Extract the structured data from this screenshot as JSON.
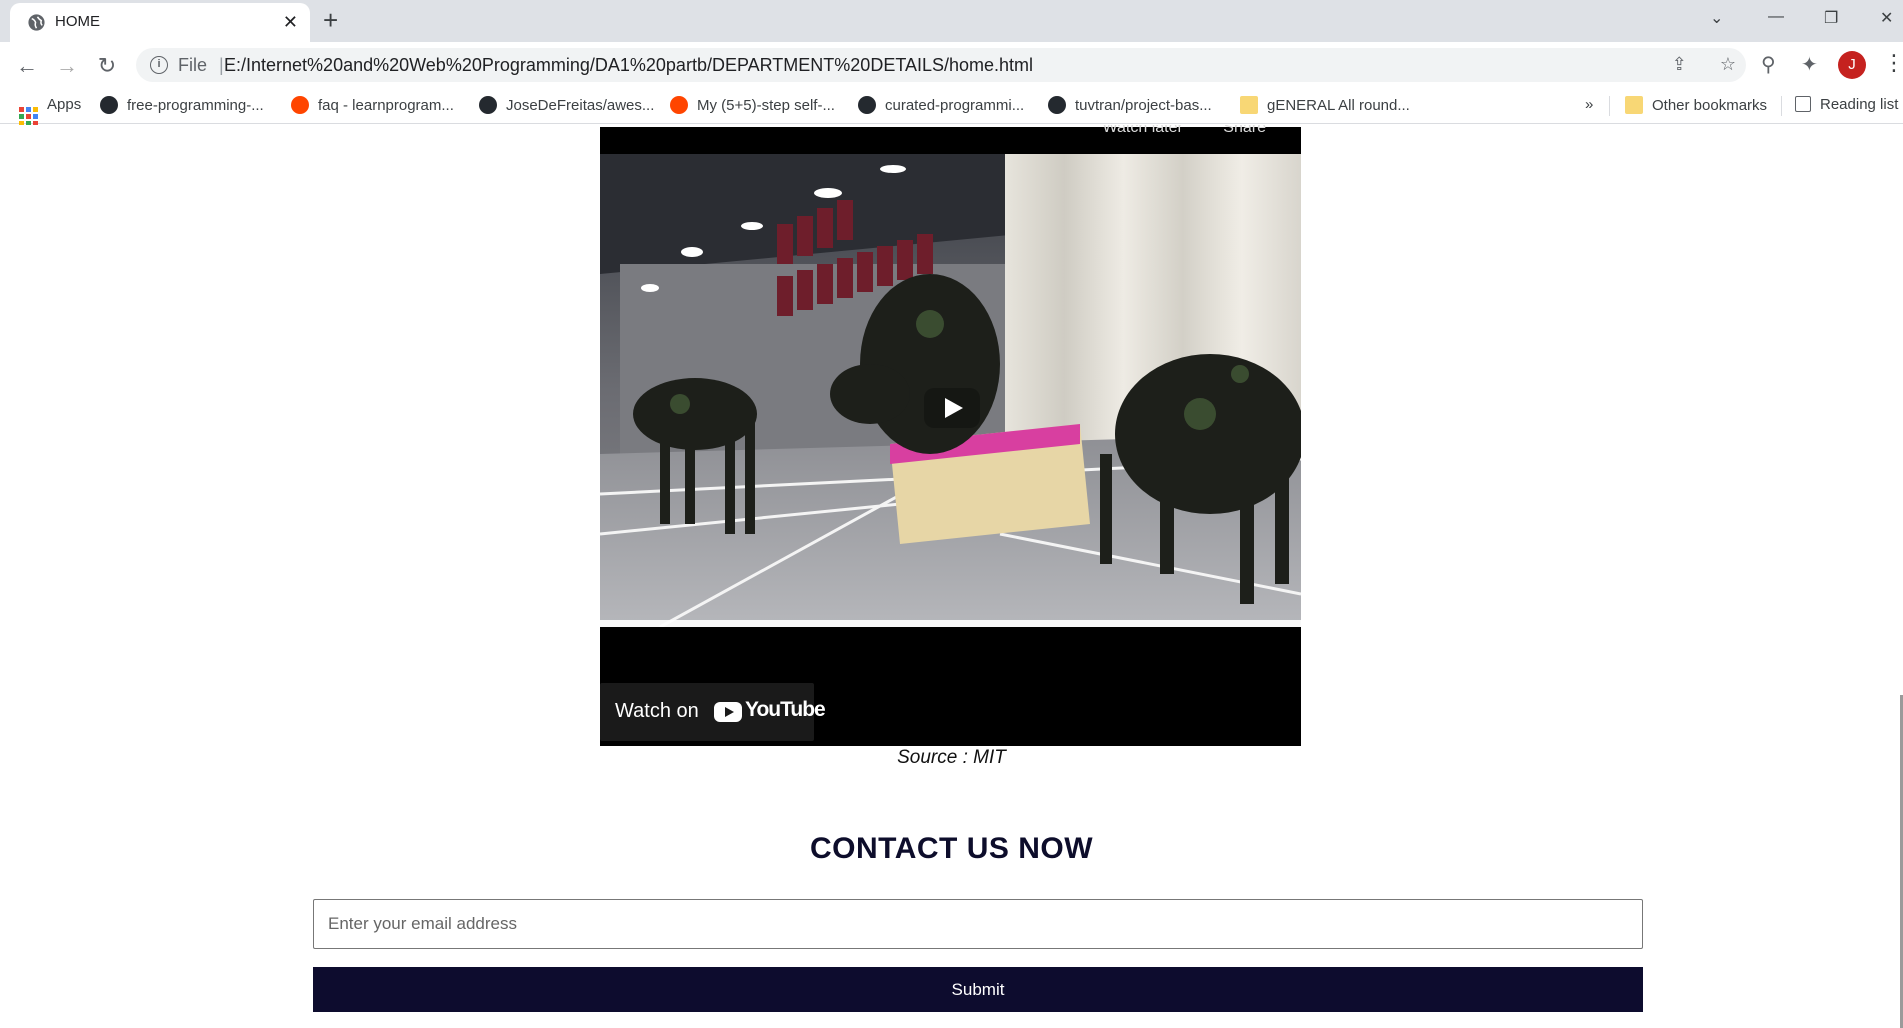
{
  "browser": {
    "tab_title": "HOME",
    "new_tab": "+",
    "url_prefix": "File",
    "url_separator": "|",
    "url": "E:/Internet%20and%20Web%20Programming/DA1%20partb/DEPARTMENT%20DETAILS/home.html",
    "avatar_letter": "J",
    "bookmarks": [
      {
        "label": "Apps",
        "icon": "apps-grid-icon"
      },
      {
        "label": "free-programming-...",
        "icon": "github-icon"
      },
      {
        "label": "faq - learnprogram...",
        "icon": "reddit-icon"
      },
      {
        "label": "JoseDeFreitas/awes...",
        "icon": "github-icon"
      },
      {
        "label": "My (5+5)-step self-...",
        "icon": "reddit-icon"
      },
      {
        "label": "curated-programmi...",
        "icon": "github-icon"
      },
      {
        "label": "tuvtran/project-bas...",
        "icon": "github-icon"
      },
      {
        "label": "gENERAL All round...",
        "icon": "folder-icon"
      }
    ],
    "bookmarks_overflow": "»",
    "other_bookmarks": "Other bookmarks",
    "reading_list": "Reading list"
  },
  "video": {
    "top_labels": [
      "Watch later",
      "Share"
    ],
    "watch_on": "Watch on",
    "youtube": "YouTube"
  },
  "caption": "Source : MIT",
  "contact": {
    "title": "CONTACT US NOW",
    "email_placeholder": "Enter your email address",
    "submit_label": "Submit"
  }
}
